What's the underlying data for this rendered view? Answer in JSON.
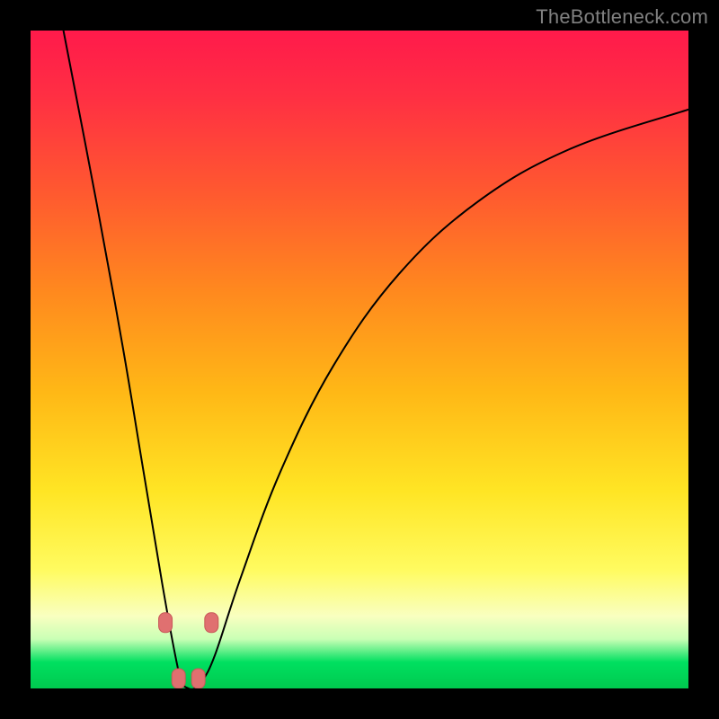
{
  "watermark": {
    "text": "TheBottleneck.com"
  },
  "colors": {
    "curve": "#000000",
    "marker_fill": "#e07070",
    "marker_stroke": "#c85858",
    "gradient_stops": [
      "#ff1a4b",
      "#ff2f43",
      "#ff5a2f",
      "#ff8a1e",
      "#ffb816",
      "#ffe524",
      "#fffb60",
      "#f9ffc0",
      "#c9ffb5",
      "#00e060",
      "#00c94f"
    ]
  },
  "chart_data": {
    "type": "line",
    "title": "",
    "xlabel": "",
    "ylabel": "",
    "x_range": [
      0,
      100
    ],
    "y_range": [
      0,
      100
    ],
    "note": "No numeric axes/ticks visible; values below are estimated relative positions (0-100). Single curve with a sharp minimum near x≈24 y≈0.",
    "series": [
      {
        "name": "bottleneck-curve",
        "points": [
          {
            "x": 5,
            "y": 100
          },
          {
            "x": 10,
            "y": 74
          },
          {
            "x": 14,
            "y": 52
          },
          {
            "x": 17,
            "y": 34
          },
          {
            "x": 20,
            "y": 16
          },
          {
            "x": 22,
            "y": 5
          },
          {
            "x": 23,
            "y": 1
          },
          {
            "x": 24,
            "y": 0
          },
          {
            "x": 25,
            "y": 0
          },
          {
            "x": 26,
            "y": 1
          },
          {
            "x": 28,
            "y": 5
          },
          {
            "x": 32,
            "y": 17
          },
          {
            "x": 38,
            "y": 33
          },
          {
            "x": 46,
            "y": 49
          },
          {
            "x": 56,
            "y": 63
          },
          {
            "x": 68,
            "y": 74
          },
          {
            "x": 82,
            "y": 82
          },
          {
            "x": 100,
            "y": 88
          }
        ]
      }
    ],
    "markers": [
      {
        "x": 20.5,
        "y": 10
      },
      {
        "x": 22.5,
        "y": 1.5
      },
      {
        "x": 25.5,
        "y": 1.5
      },
      {
        "x": 27.5,
        "y": 10
      }
    ]
  }
}
